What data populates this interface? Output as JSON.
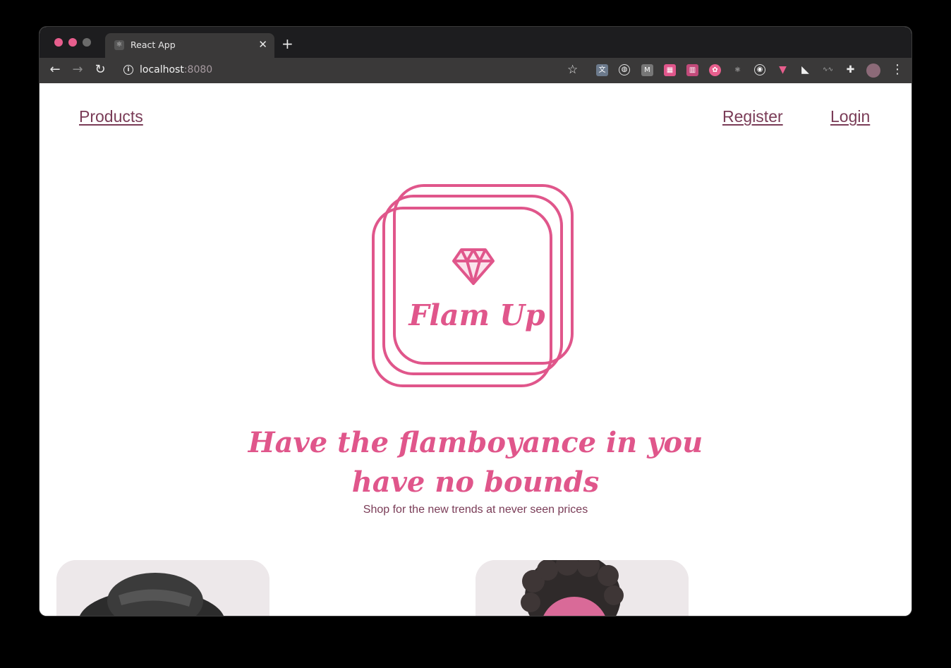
{
  "browser": {
    "tab": {
      "title": "React App",
      "favicon": "react-logo-icon",
      "close_glyph": "✕"
    },
    "new_tab_glyph": "+",
    "address": {
      "host": "localhost",
      "port": ":8080"
    },
    "colors": {
      "close": "#e75e8d",
      "minimize": "#e75e8d",
      "maximize": "#6b6b6b"
    }
  },
  "nav": {
    "products": "Products",
    "register": "Register",
    "login": "Login"
  },
  "hero": {
    "brand": "Flam Up",
    "headline_line1": "Have the flamboyance in you",
    "headline_line2": "have no bounds",
    "subtitle": "Shop for the new trends at never seen prices"
  },
  "theme": {
    "accent": "#e0568b",
    "link": "#7a3c57"
  },
  "products": [
    {
      "image": "person-in-hat-photo"
    },
    {
      "image": "person-with-curly-hair-photo"
    }
  ]
}
